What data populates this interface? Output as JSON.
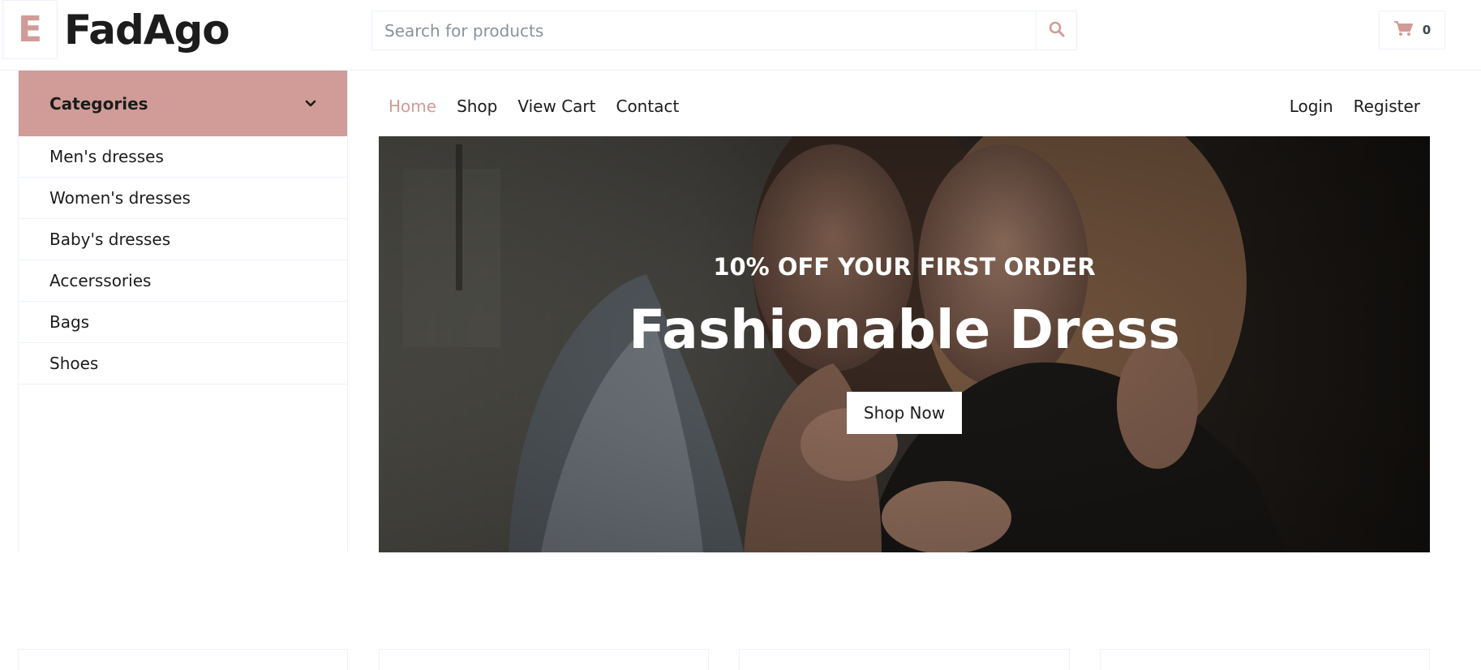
{
  "brand": {
    "logo_letter": "E",
    "name": "FadAgo",
    "accent_color": "#D19C97"
  },
  "search": {
    "placeholder": "Search for products",
    "icon": "search-icon"
  },
  "cart": {
    "icon": "cart-icon",
    "count": "0"
  },
  "categories": {
    "title": "Categories",
    "toggle_icon": "chevron-down-icon",
    "items": [
      {
        "label": "Men's dresses"
      },
      {
        "label": "Women's dresses"
      },
      {
        "label": "Baby's dresses"
      },
      {
        "label": "Accerssories"
      },
      {
        "label": "Bags"
      },
      {
        "label": "Shoes"
      }
    ]
  },
  "nav": {
    "left": [
      {
        "label": "Home",
        "active": true
      },
      {
        "label": "Shop"
      },
      {
        "label": "View Cart"
      },
      {
        "label": "Contact"
      }
    ],
    "right": [
      {
        "label": "Login"
      },
      {
        "label": "Register"
      }
    ]
  },
  "hero": {
    "subtitle": "10% OFF YOUR FIRST ORDER",
    "title": "Fashionable Dress",
    "button_label": "Shop Now"
  }
}
